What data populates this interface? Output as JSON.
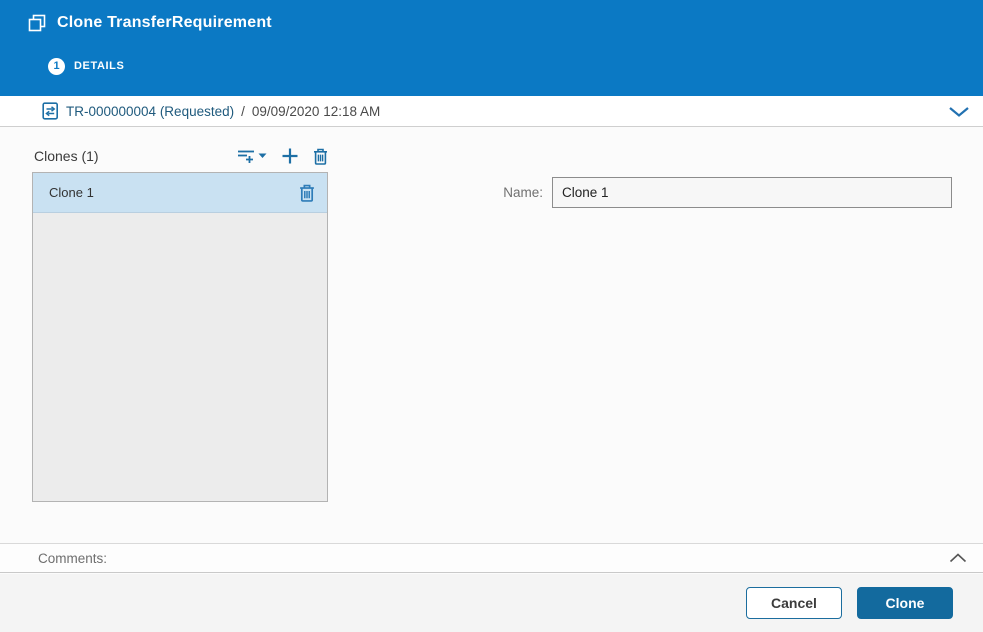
{
  "header": {
    "title": "Clone TransferRequirement",
    "step": {
      "number": "1",
      "label": "DETAILS"
    }
  },
  "record_bar": {
    "link_text": "TR-000000004 (Requested)",
    "separator": "/",
    "timestamp": "09/09/2020 12:18 AM"
  },
  "clones": {
    "heading": "Clones (1)",
    "items": [
      {
        "name": "Clone 1",
        "selected": true
      }
    ]
  },
  "form": {
    "name_label": "Name:",
    "name_value": "Clone 1"
  },
  "comments": {
    "label": "Comments:"
  },
  "footer": {
    "cancel_label": "Cancel",
    "clone_label": "Clone"
  },
  "icons": {
    "header": "clone-icon",
    "record": "transfer-record-icon",
    "record_bar_right": "chevron-down-icon",
    "toolbar": [
      "add-multiple-icon",
      "plus-icon",
      "trash-icon"
    ],
    "list_item": "trash-icon",
    "comments_right": "chevron-up-icon"
  },
  "colors": {
    "header_blue": "#0b79c4",
    "accent_blue": "#1d6fa5",
    "button_blue": "#136a9e",
    "link_navy": "#1f5a7d",
    "selected_item_bg": "#c9e1f2",
    "list_panel_bg": "#ececec"
  }
}
